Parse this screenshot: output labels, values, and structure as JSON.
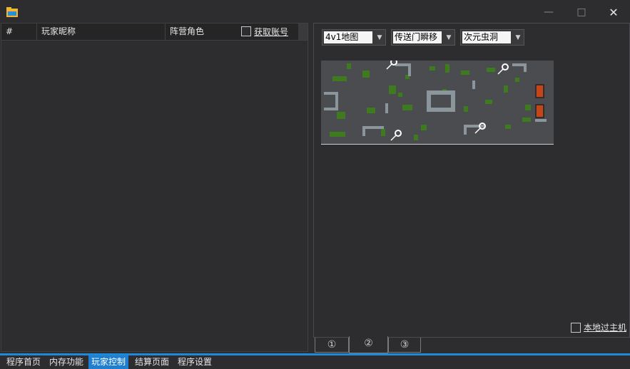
{
  "window": {
    "minimize_icon": "minimize-icon",
    "maximize_icon": "maximize-icon",
    "close_icon": "close-icon",
    "app_icon": "folder-icon"
  },
  "player_list": {
    "columns": [
      "#",
      "玩家昵称",
      "阵营角色"
    ],
    "get_account_label": "获取账号",
    "rows": []
  },
  "controls": {
    "map_select": "4v1地图",
    "teleport_select": "传送门瞬移",
    "wormhole_select": "次元虫洞",
    "local_host_label": "本地过主机"
  },
  "page_tabs": [
    "①",
    "②",
    "③"
  ],
  "active_page_tab": 1,
  "bottom_nav": [
    "程序首页",
    "内存功能",
    "玩家控制",
    "结算页面",
    "程序设置"
  ],
  "active_nav": 2,
  "colors": {
    "accent": "#1e88d9",
    "background": "#2d2d30",
    "map_floor": "#4a4c4f",
    "map_grass": "#3e7a1e",
    "map_door": "#c2461c"
  }
}
